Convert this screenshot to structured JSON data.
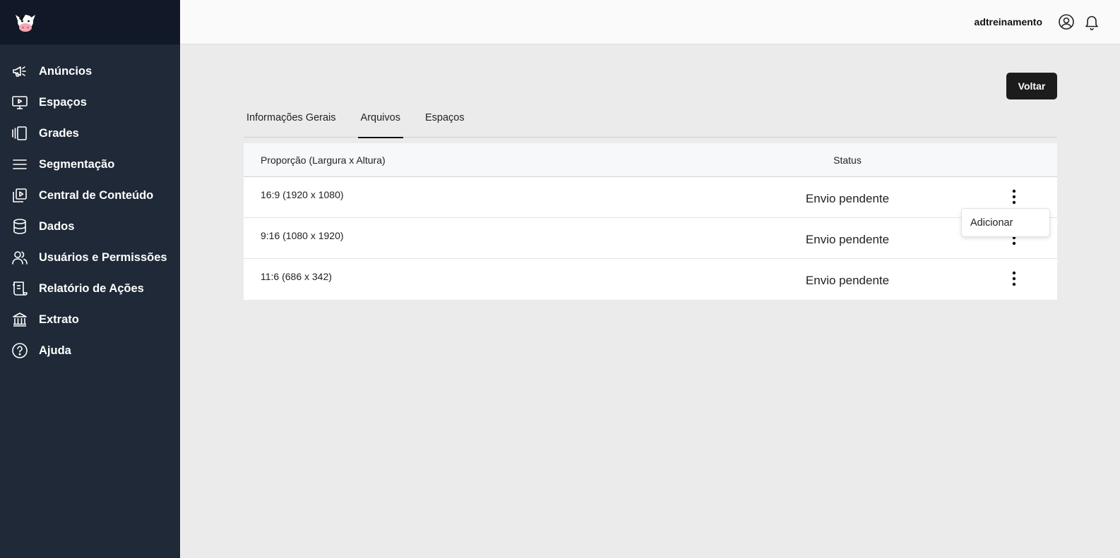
{
  "app": {
    "logo_icon": "cow-logo-icon"
  },
  "sidebar": {
    "items": [
      {
        "label": "Anúncios",
        "icon": "megaphone-icon"
      },
      {
        "label": "Espaços",
        "icon": "monitor-play-icon"
      },
      {
        "label": "Grades",
        "icon": "carousel-icon"
      },
      {
        "label": "Segmentação",
        "icon": "menu-lines-icon"
      },
      {
        "label": "Central de Conteúdo",
        "icon": "video-library-icon"
      },
      {
        "label": "Dados",
        "icon": "database-icon"
      },
      {
        "label": "Usuários e Permissões",
        "icon": "users-icon"
      },
      {
        "label": "Relatório de Ações",
        "icon": "report-icon"
      },
      {
        "label": "Extrato",
        "icon": "bank-icon"
      },
      {
        "label": "Ajuda",
        "icon": "help-circle-icon"
      }
    ]
  },
  "header": {
    "username": "adtreinamento",
    "user_icon": "user-circle-icon",
    "bell_icon": "bell-icon"
  },
  "actions": {
    "back_label": "Voltar"
  },
  "tabs": [
    {
      "label": "Informações Gerais",
      "active": false
    },
    {
      "label": "Arquivos",
      "active": true
    },
    {
      "label": "Espaços",
      "active": false
    }
  ],
  "table": {
    "columns": [
      "Proporção (Largura x Altura)",
      "Status"
    ],
    "rows": [
      {
        "proportion": "16:9 (1920 x 1080)",
        "status": "Envio pendente"
      },
      {
        "proportion": "9:16 (1080 x 1920)",
        "status": "Envio pendente"
      },
      {
        "proportion": "11:6 (686 x 342)",
        "status": "Envio pendente"
      }
    ]
  },
  "dropdown": {
    "item": "Adicionar"
  },
  "colors": {
    "sidebar_bg": "#1f2937",
    "sidebar_head_bg": "#111827",
    "content_bg": "#ebebeb",
    "button_bg": "#1c1c1c"
  }
}
